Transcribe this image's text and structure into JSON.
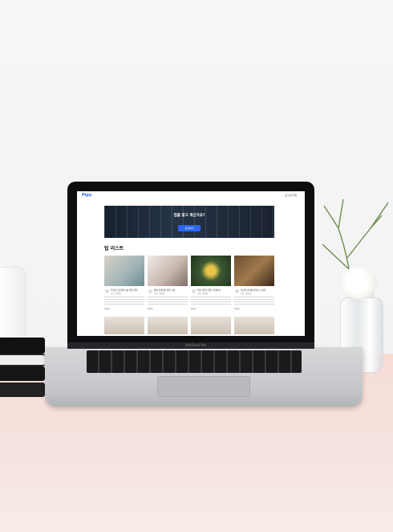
{
  "screen": {
    "logo": "Pipy",
    "login": "로그인/가입",
    "hero": {
      "title": "집을 찾고 계신가요?",
      "subtitle": "",
      "button": "검색하기"
    },
    "section_title": "팁 리스트",
    "cards": [
      {
        "title": "우리집 오픈하우스를 위한 꿀팁",
        "meta": "조회 · 좋아요",
        "author": "작성자"
      },
      {
        "title": "원룸 인테리어 꿀팁 모음",
        "meta": "조회 · 좋아요",
        "author": "작성자"
      },
      {
        "title": "식물 키우기 좋은 인테리어",
        "meta": "조회 · 좋아요",
        "author": "작성자"
      },
      {
        "title": "나만의 홈카페 만들기 노하우",
        "meta": "조회 · 좋아요",
        "author": "작성자"
      }
    ]
  },
  "laptop": {
    "brand": "MacBook Pro"
  }
}
